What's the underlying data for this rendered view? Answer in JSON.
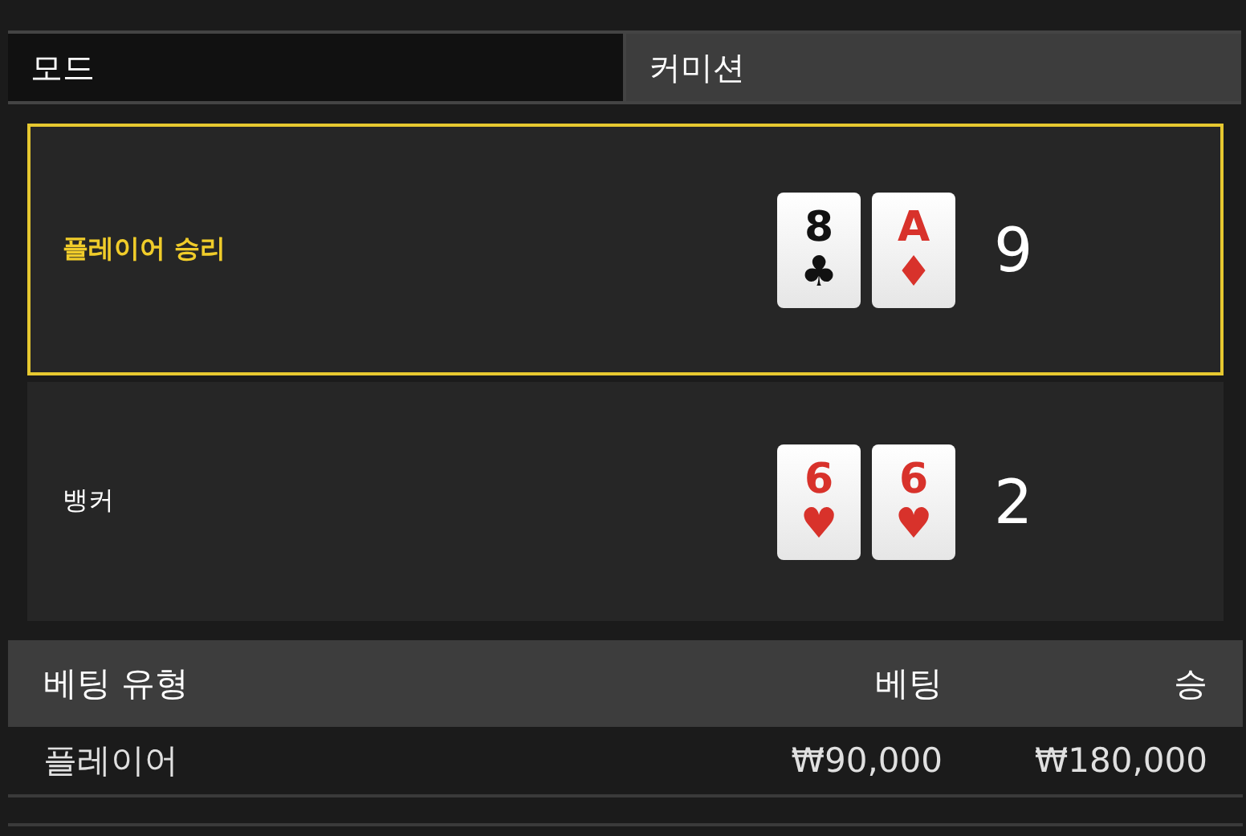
{
  "tabs": [
    {
      "label": "모드",
      "selected": true
    },
    {
      "label": "커미션",
      "selected": false
    }
  ],
  "results": [
    {
      "label": "플레이어 승리",
      "winner": true,
      "cards": [
        {
          "rank": "8",
          "suit": "♣",
          "color": "#111111"
        },
        {
          "rank": "A",
          "suit": "♦",
          "color": "#d8322b"
        }
      ],
      "score": "9"
    },
    {
      "label": "뱅커",
      "winner": false,
      "cards": [
        {
          "rank": "6",
          "suit": "♥",
          "color": "#d8322b"
        },
        {
          "rank": "6",
          "suit": "♥",
          "color": "#d8322b"
        }
      ],
      "score": "2"
    }
  ],
  "table": {
    "columns": [
      "베팅 유형",
      "베팅",
      "승"
    ],
    "rows": [
      [
        "플레이어",
        "₩90,000",
        "₩180,000"
      ]
    ]
  }
}
